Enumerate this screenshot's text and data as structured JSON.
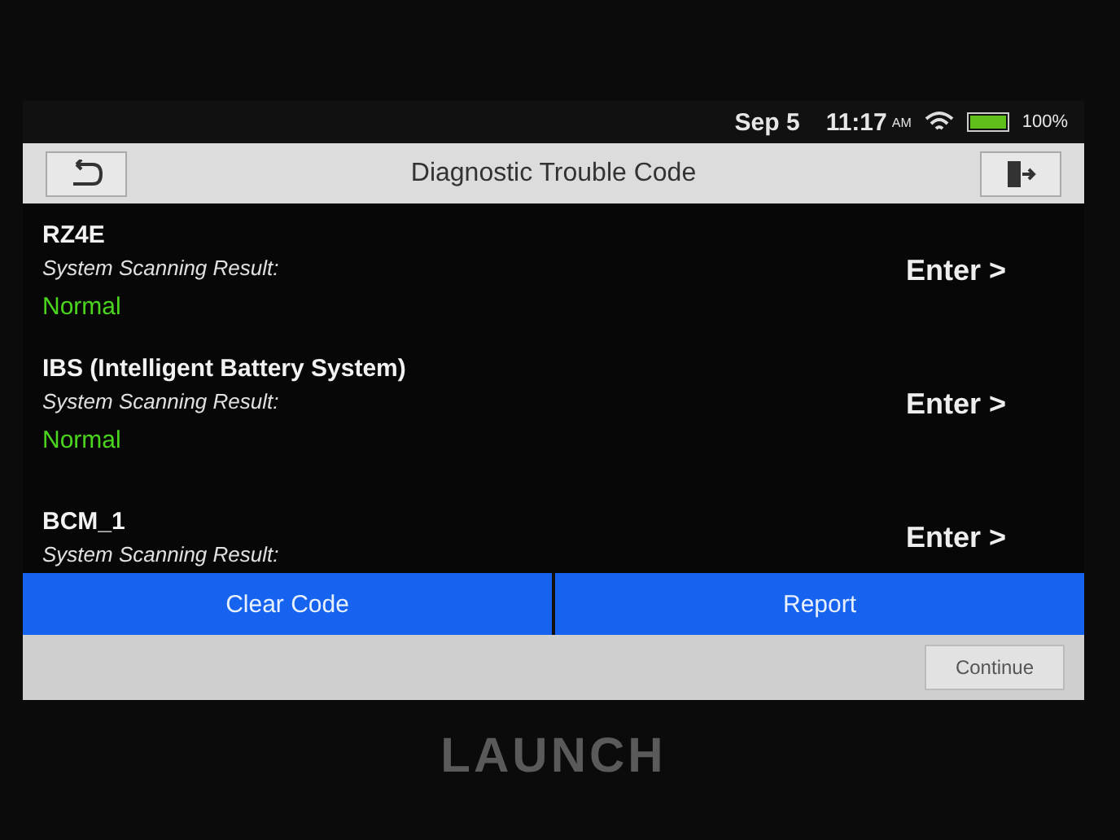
{
  "status_bar": {
    "date": "Sep 5",
    "time": "11:17",
    "ampm": "AM",
    "battery": "100%"
  },
  "title_bar": {
    "title": "Diagnostic Trouble Code"
  },
  "systems": [
    {
      "name": "RZ4E",
      "result_label": "System Scanning Result:",
      "result": "Normal",
      "action": "Enter >"
    },
    {
      "name": "IBS (Intelligent Battery System)",
      "result_label": "System Scanning Result:",
      "result": "Normal",
      "action": "Enter >"
    },
    {
      "name": "BCM_1",
      "result_label": "System Scanning Result:",
      "action": "Enter >"
    }
  ],
  "action_buttons": [
    "Clear Code",
    "Report"
  ],
  "footer_button": "Continue",
  "device_bezel": {
    "brand": "LAUNCH"
  }
}
